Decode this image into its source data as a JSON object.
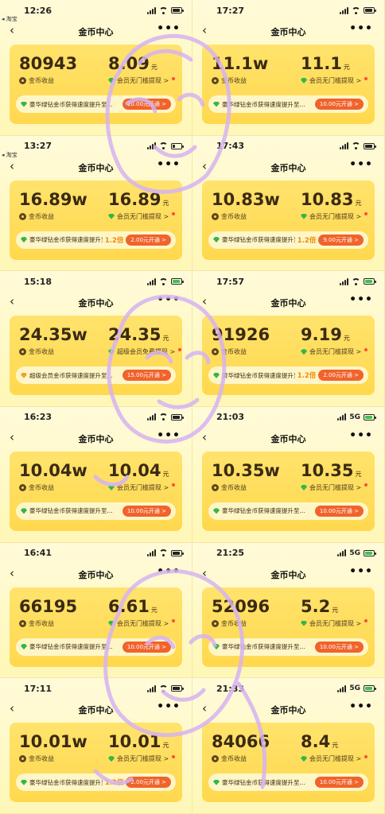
{
  "panels": [
    {
      "time": "12:26",
      "battery": "black",
      "network": "",
      "title": "金币中心",
      "coins": "80943",
      "coins_label": "金币收益",
      "cash": "8.09",
      "cash_unit": "元",
      "cash_label": "会员无门槛提现 >",
      "bar_text": "豪华绿钻金币获得速度提升至...",
      "bar_mult": "",
      "bar_button": "10.00元开通 >",
      "back_small": "◂ 淘宝"
    },
    {
      "time": "17:27",
      "battery": "black",
      "network": "",
      "title": "金币中心",
      "coins": "11.1w",
      "coins_label": "金币收益",
      "cash": "11.1",
      "cash_unit": "元",
      "cash_label": "会员无门槛提现 >",
      "bar_text": "豪华绿钻金币获得速度提升至...",
      "bar_mult": "",
      "bar_button": "10.00元开通 >",
      "back_small": ""
    },
    {
      "time": "13:27",
      "battery": "low",
      "network": "",
      "title": "金币中心",
      "coins": "16.89w",
      "coins_label": "金币收益",
      "cash": "16.89",
      "cash_unit": "元",
      "cash_label": "会员无门槛提现 >",
      "bar_text": "豪华绿钻金币获得速度提升至",
      "bar_mult": "1.2倍",
      "bar_button": "2.00元开通 >",
      "back_small": "◂ 淘宝"
    },
    {
      "time": "17:43",
      "battery": "black",
      "network": "",
      "title": "金币中心",
      "coins": "10.83w",
      "coins_label": "金币收益",
      "cash": "10.83",
      "cash_unit": "元",
      "cash_label": "会员无门槛提现 >",
      "bar_text": "豪华绿钻金币获得速度提升至",
      "bar_mult": "1.2倍",
      "bar_button": "9.00元开通 >",
      "back_small": ""
    },
    {
      "time": "15:18",
      "battery": "green",
      "network": "",
      "title": "金币中心",
      "coins": "24.35w",
      "coins_label": "金币收益",
      "cash": "24.35",
      "cash_unit": "元",
      "cash_label": "超级会员免费提现 >",
      "bar_text": "超级会员金币获得速度提升至...",
      "bar_mult": "",
      "bar_button": "15.00元开通 >",
      "back_small": ""
    },
    {
      "time": "17:57",
      "battery": "green",
      "network": "",
      "title": "金币中心",
      "coins": "91926",
      "coins_label": "金币收益",
      "cash": "9.19",
      "cash_unit": "元",
      "cash_label": "会员无门槛提现 >",
      "bar_text": "豪华绿钻金币获得速度提升至",
      "bar_mult": "1.2倍",
      "bar_button": "2.00元开通 >",
      "back_small": ""
    },
    {
      "time": "16:23",
      "battery": "black",
      "network": "",
      "title": "金币中心",
      "coins": "10.04w",
      "coins_label": "金币收益",
      "cash": "10.04",
      "cash_unit": "元",
      "cash_label": "会员无门槛提现 >",
      "bar_text": "豪华绿钻金币获得速度提升至...",
      "bar_mult": "",
      "bar_button": "10.00元开通 >",
      "back_small": ""
    },
    {
      "time": "21:03",
      "battery": "green",
      "network": "5G",
      "title": "金币中心",
      "coins": "10.35w",
      "coins_label": "金币收益",
      "cash": "10.35",
      "cash_unit": "元",
      "cash_label": "会员无门槛提现 >",
      "bar_text": "豪华绿钻金币获得速度提升至...",
      "bar_mult": "",
      "bar_button": "10.00元开通 >",
      "back_small": ""
    },
    {
      "time": "16:41",
      "battery": "black",
      "network": "",
      "title": "金币中心",
      "coins": "66195",
      "coins_label": "金币收益",
      "cash": "6.61",
      "cash_unit": "元",
      "cash_label": "会员无门槛提现 >",
      "bar_text": "豪华绿钻金币获得速度提升至...",
      "bar_mult": "",
      "bar_button": "10.00元开通 >",
      "back_small": ""
    },
    {
      "time": "21:25",
      "battery": "green",
      "network": "5G",
      "title": "金币中心",
      "coins": "52096",
      "coins_label": "金币收益",
      "cash": "5.2",
      "cash_unit": "元",
      "cash_label": "会员无门槛提现 >",
      "bar_text": "豪华绿钻金币获得速度提升至...",
      "bar_mult": "",
      "bar_button": "10.00元开通 >",
      "back_small": ""
    },
    {
      "time": "17:11",
      "battery": "black",
      "network": "",
      "title": "金币中心",
      "coins": "10.01w",
      "coins_label": "金币收益",
      "cash": "10.01",
      "cash_unit": "元",
      "cash_label": "会员无门槛提现 >",
      "bar_text": "豪华绿钻金币获得速度提升至",
      "bar_mult": "1.2倍",
      "bar_button": "2.00元开通 >",
      "back_small": ""
    },
    {
      "time": "21:33",
      "battery": "green",
      "network": "5G",
      "title": "金币中心",
      "coins": "84066",
      "coins_label": "金币收益",
      "cash": "8.4",
      "cash_unit": "元",
      "cash_label": "会员无门槛提现 >",
      "bar_text": "豪华绿钻金币获得速度提升至...",
      "bar_mult": "",
      "bar_button": "10.00元开通 >",
      "back_small": ""
    }
  ],
  "colors": {
    "card": "#ffd84e",
    "button": "#f0632c",
    "gem": "#2fb84a",
    "doodle": "#d6b3f2"
  }
}
